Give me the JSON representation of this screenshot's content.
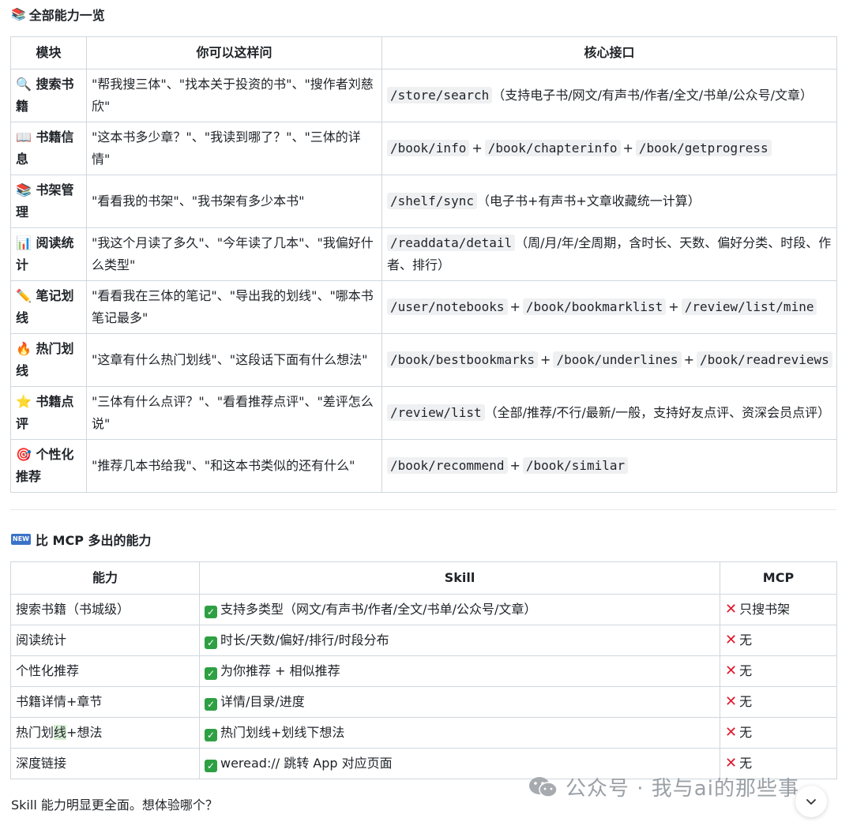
{
  "section1": {
    "emoji": "📚",
    "title": "全部能力一览",
    "headers": [
      "模块",
      "你可以这样问",
      "核心接口"
    ],
    "rows": [
      {
        "emoji": "🔍",
        "module": "搜索书籍",
        "ask": "\"帮我搜三体\"、\"找本关于投资的书\"、\"搜作者刘慈欣\"",
        "apis": [
          "/store/search"
        ],
        "note": "（支持电子书/网文/有声书/作者/全文/书单/公众号/文章）"
      },
      {
        "emoji": "📖",
        "module": "书籍信息",
        "ask": "\"这本书多少章？\"、\"我读到哪了？\"、\"三体的详情\"",
        "apis": [
          "/book/info",
          "/book/chapterinfo",
          "/book/getprogress"
        ],
        "note": ""
      },
      {
        "emoji": "📚",
        "module": "书架管理",
        "ask": "\"看看我的书架\"、\"我书架有多少本书\"",
        "apis": [
          "/shelf/sync"
        ],
        "note": "（电子书+有声书+文章收藏统一计算）"
      },
      {
        "emoji": "📊",
        "module": "阅读统计",
        "ask": "\"我这个月读了多久\"、\"今年读了几本\"、\"我偏好什么类型\"",
        "apis": [
          "/readdata/detail"
        ],
        "note": "（周/月/年/全周期，含时长、天数、偏好分类、时段、作者、排行）"
      },
      {
        "emoji": "✏️",
        "module": "笔记划线",
        "ask": "\"看看我在三体的笔记\"、\"导出我的划线\"、\"哪本书笔记最多\"",
        "apis": [
          "/user/notebooks",
          "/book/bookmarklist",
          "/review/list/mine"
        ],
        "note": ""
      },
      {
        "emoji": "🔥",
        "module": "热门划线",
        "ask": "\"这章有什么热门划线\"、\"这段话下面有什么想法\"",
        "apis": [
          "/book/bestbookmarks",
          "/book/underlines",
          "/book/readreviews"
        ],
        "note": ""
      },
      {
        "emoji": "⭐",
        "module": "书籍点评",
        "ask": "\"三体有什么点评？\"、\"看看推荐点评\"、\"差评怎么说\"",
        "apis": [
          "/review/list"
        ],
        "note": "（全部/推荐/不行/最新/一般，支持好友点评、资深会员点评）"
      },
      {
        "emoji": "🎯",
        "module": "个性化推荐",
        "ask": "\"推荐几本书给我\"、\"和这本书类似的还有什么\"",
        "apis": [
          "/book/recommend",
          "/book/similar"
        ],
        "note": ""
      }
    ]
  },
  "section2": {
    "badge": "NEW",
    "title": "比 MCP 多出的能力",
    "headers": [
      "能力",
      "Skill",
      "MCP"
    ],
    "rows": [
      {
        "cap": "搜索书籍（书城级）",
        "skill": "支持多类型（网文/有声书/作者/全文/书单/公众号/文章）",
        "mcp": "只搜书架"
      },
      {
        "cap": "阅读统计",
        "skill": "时长/天数/偏好/排行/时段分布",
        "mcp": "无"
      },
      {
        "cap": "个性化推荐",
        "skill": "为你推荐 + 相似推荐",
        "mcp": "无"
      },
      {
        "cap": "书籍详情+章节",
        "skill": "详情/目录/进度",
        "mcp": "无"
      },
      {
        "cap_parts": [
          "热门划",
          "线",
          "+想法"
        ],
        "skill": "热门划线+划线下想法",
        "mcp": "无"
      },
      {
        "cap": "深度链接",
        "skill": "weread:// 跳转 App 对应页面",
        "mcp": "无"
      }
    ]
  },
  "footer": "Skill 能力明显更全面。想体验哪个？",
  "watermark": "公众号 · 我与ai的那些事",
  "plus_sign": "+",
  "colors": {
    "check": "#2ea043",
    "cross": "#e0162b",
    "border": "#d0d7de",
    "code_bg": "#eef0f2"
  },
  "icons": {
    "check": "check-mark-icon",
    "cross": "cross-mark-icon",
    "wechat": "wechat-icon",
    "scroll": "chevron-down-icon"
  }
}
